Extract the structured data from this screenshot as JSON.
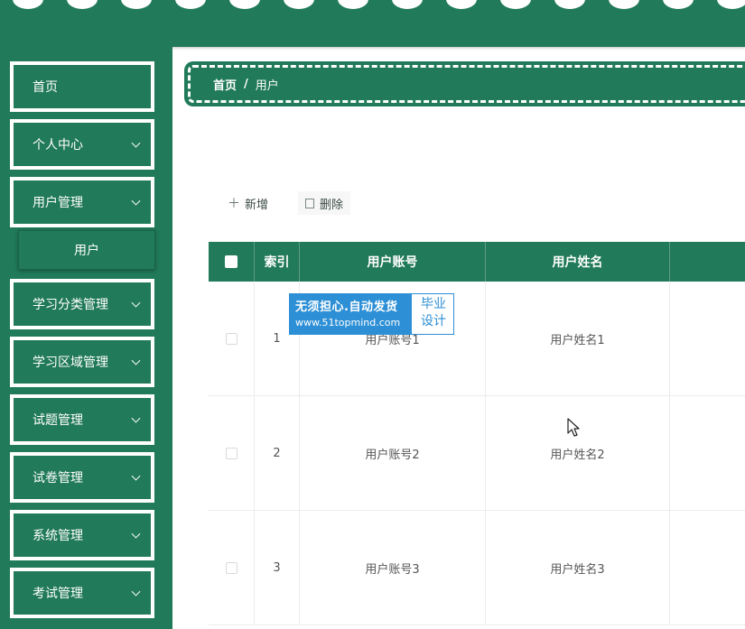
{
  "header": {
    "bg_color": "#217a5a"
  },
  "sidebar": {
    "items": [
      {
        "label": "首页",
        "has_chevron": false
      },
      {
        "label": "个人中心",
        "has_chevron": true
      },
      {
        "label": "用户管理",
        "has_chevron": true
      },
      {
        "label": "学习分类管理",
        "has_chevron": true
      },
      {
        "label": "学习区域管理",
        "has_chevron": true
      },
      {
        "label": "试题管理",
        "has_chevron": true
      },
      {
        "label": "试卷管理",
        "has_chevron": true
      },
      {
        "label": "系统管理",
        "has_chevron": true
      },
      {
        "label": "考试管理",
        "has_chevron": true
      }
    ],
    "submenu": {
      "label": "用户"
    }
  },
  "breadcrumb": {
    "home": "首页",
    "separator": "/",
    "current": "用户"
  },
  "toolbar": {
    "add_label": "新增",
    "add_icon": "plus-icon",
    "delete_label": "删除",
    "delete_icon": "trash-icon"
  },
  "table": {
    "columns": [
      "",
      "索引",
      "用户账号",
      "用户姓名",
      ""
    ],
    "rows": [
      {
        "index": "1",
        "account": "用户账号1",
        "name": "用户姓名1"
      },
      {
        "index": "2",
        "account": "用户账号2",
        "name": "用户姓名2"
      },
      {
        "index": "3",
        "account": "用户账号3",
        "name": "用户姓名3"
      }
    ]
  },
  "watermark": {
    "line1": "无须担心.自动发货",
    "line2": "www.51topmind.com",
    "right_line1": "毕业",
    "right_line2": "设计"
  },
  "colors": {
    "accent": "#217a5a",
    "watermark_blue": "#2d8fd5"
  }
}
